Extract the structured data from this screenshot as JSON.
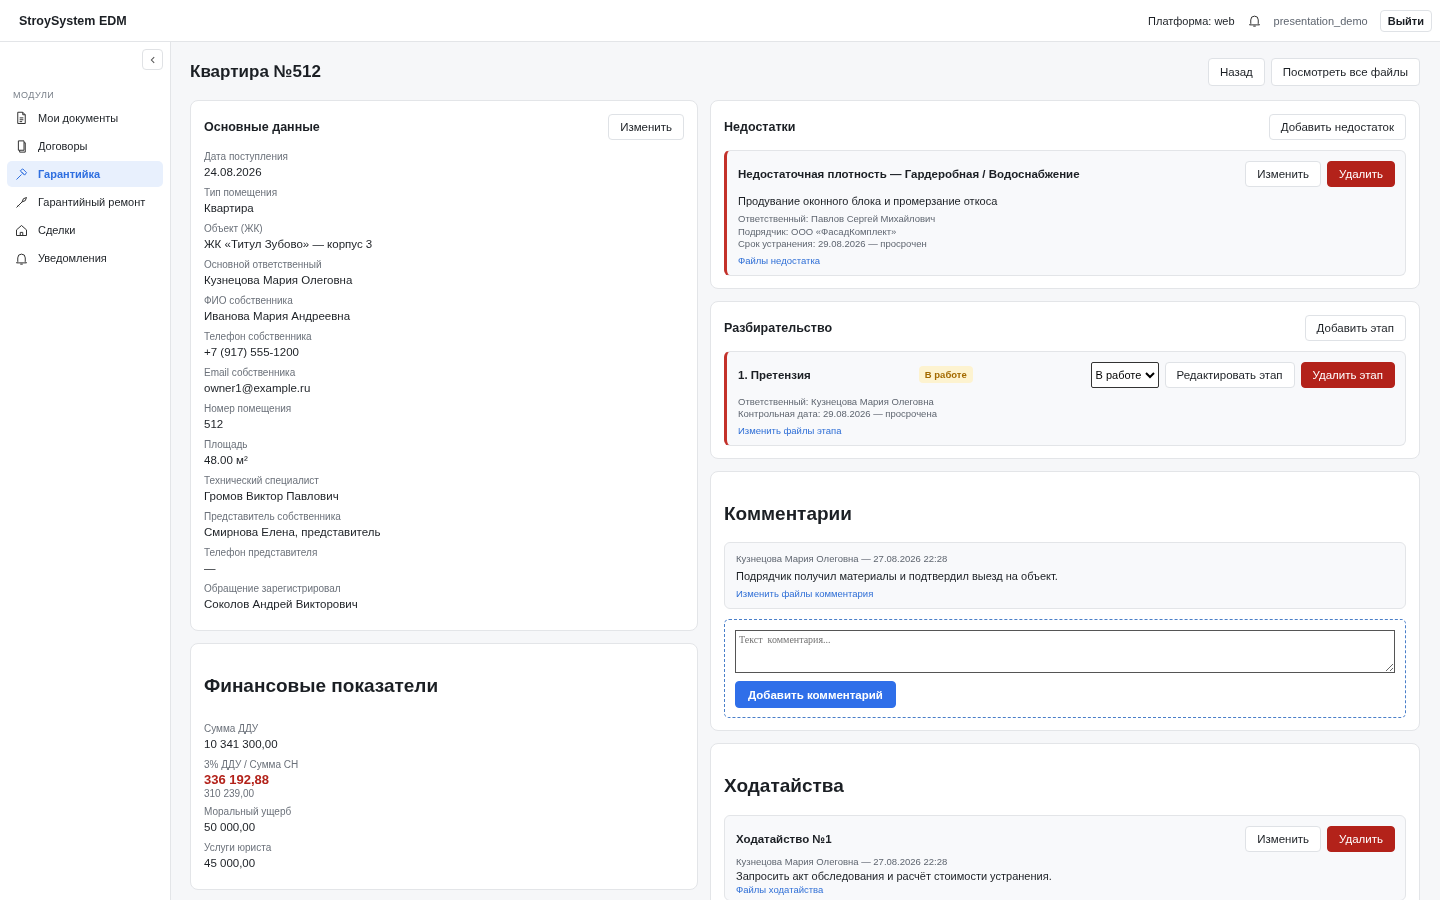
{
  "app": {
    "brand": "StroySystem EDM",
    "platform": "Платформа: web",
    "user": "presentation_demo",
    "logout": "Выйти"
  },
  "sidebar": {
    "section": "МОДУЛИ",
    "items": [
      {
        "label": "Мои документы",
        "selected": false
      },
      {
        "label": "Договоры",
        "selected": false
      },
      {
        "label": "Гарантийка",
        "selected": true
      },
      {
        "label": "Гарантийный ремонт",
        "selected": false
      },
      {
        "label": "Сделки",
        "selected": false
      },
      {
        "label": "Уведомления",
        "selected": false
      }
    ]
  },
  "page": {
    "title": "Квартира №512",
    "buttons": [
      "Назад",
      "Посмотреть все файлы"
    ]
  },
  "main_data": {
    "title": "Основные данные",
    "edit_button": "Изменить",
    "fields": [
      {
        "label": "Дата поступления",
        "value": "24.08.2026"
      },
      {
        "label": "Тип помещения",
        "value": "Квартира"
      },
      {
        "label": "Объект (ЖК)",
        "value": "ЖК «Титул Зубово» — корпус 3"
      },
      {
        "label": "Основной ответственный",
        "value": "Кузнецова Мария Олеговна"
      },
      {
        "label": "ФИО собственника",
        "value": "Иванова Мария Андреевна"
      },
      {
        "label": "Телефон собственника",
        "value": "+7 (917) 555-1200"
      },
      {
        "label": "Email собственника",
        "value": "owner1@example.ru"
      },
      {
        "label": "Номер помещения",
        "value": "512"
      },
      {
        "label": "Площадь",
        "value": "48.00 м²"
      },
      {
        "label": "Технический специалист",
        "value": "Громов Виктор Павлович"
      },
      {
        "label": "Представитель собственника",
        "value": "Смирнова Елена, представитель"
      },
      {
        "label": "Телефон представителя",
        "value": "—"
      },
      {
        "label": "Обращение зарегистрировал",
        "value": "Соколов Андрей Викторович"
      }
    ]
  },
  "finance": {
    "title": "Финансовые показатели",
    "fields": [
      {
        "label": "Сумма ДДУ",
        "value": "10 341 300,00",
        "highlight": false
      },
      {
        "label": "3% ДДУ / Сумма СН",
        "value": "336 192,88",
        "secondary": "310 239,00",
        "highlight": true
      },
      {
        "label": "Моральный ущерб",
        "value": "50 000,00",
        "highlight": false
      },
      {
        "label": "Услуги юриста",
        "value": "45 000,00",
        "highlight": false
      }
    ]
  },
  "defects": {
    "title": "Недостатки",
    "add_button": "Добавить недостаток",
    "items": [
      {
        "title": "Недостаточная плотность — Гардеробная / Водоснабжение",
        "description": "Продувание оконного блока и промерзание откоса",
        "details": [
          "Ответственный: Павлов Сергей Михайлович",
          "Подрядчик: ООО «ФасадКомплект»",
          "Срок устранения: 29.08.2026 — просрочен"
        ],
        "link": "Файлы недостатка",
        "edit": "Изменить",
        "delete": "Удалить"
      }
    ]
  },
  "proceedings": {
    "title": "Разбирательство",
    "add_button": "Добавить этап",
    "stages": [
      {
        "title": "1. Претензия",
        "status": "В работе",
        "status_select": "В работе",
        "details": [
          "Ответственный: Кузнецова Мария Олеговна",
          "Контрольная дата: 29.08.2026 — просрочена"
        ],
        "link": "Изменить файлы этапа",
        "edit": "Редактировать этап",
        "delete": "Удалить этап"
      }
    ]
  },
  "comments": {
    "title": "Комментарии",
    "items": [
      {
        "meta": "Кузнецова Мария Олеговна — 27.08.2026 22:28",
        "text": "Подрядчик получил материалы и подтвердил выезд на объект.",
        "link": "Изменить файлы комментария"
      }
    ],
    "input": {
      "placeholder": "Текст  комментария..."
    },
    "submit": "Добавить комментарий"
  },
  "petitions": {
    "title": "Ходатайства",
    "items": [
      {
        "title": "Ходатайство №1",
        "meta": "Кузнецова Мария Олеговна — 27.08.2026 22:28",
        "text": "Запросить акт обследования и расчёт стоимости устранения.",
        "link": "Файлы ходатайства",
        "edit": "Изменить",
        "delete": "Удалить"
      }
    ]
  }
}
